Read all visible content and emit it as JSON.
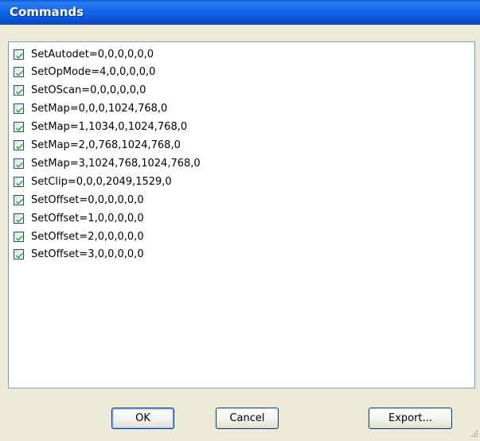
{
  "window": {
    "title": "Commands"
  },
  "commands": [
    {
      "label": "SetAutodet=0,0,0,0,0,0",
      "checked": true
    },
    {
      "label": "SetOpMode=4,0,0,0,0,0",
      "checked": true
    },
    {
      "label": "SetOScan=0,0,0,0,0,0",
      "checked": true
    },
    {
      "label": "SetMap=0,0,0,1024,768,0",
      "checked": true
    },
    {
      "label": "SetMap=1,1034,0,1024,768,0",
      "checked": true
    },
    {
      "label": "SetMap=2,0,768,1024,768,0",
      "checked": true
    },
    {
      "label": "SetMap=3,1024,768,1024,768,0",
      "checked": true
    },
    {
      "label": "SetClip=0,0,0,2049,1529,0",
      "checked": true
    },
    {
      "label": "SetOffset=0,0,0,0,0,0",
      "checked": true
    },
    {
      "label": "SetOffset=1,0,0,0,0,0",
      "checked": true
    },
    {
      "label": "SetOffset=2,0,0,0,0,0",
      "checked": true
    },
    {
      "label": "SetOffset=3,0,0,0,0,0",
      "checked": true
    }
  ],
  "buttons": {
    "ok": "OK",
    "cancel": "Cancel",
    "export": "Export..."
  },
  "colors": {
    "titlebar": "#0a5bd6",
    "checkmark": "#21a121",
    "dialog_bg": "#ece9d8"
  }
}
